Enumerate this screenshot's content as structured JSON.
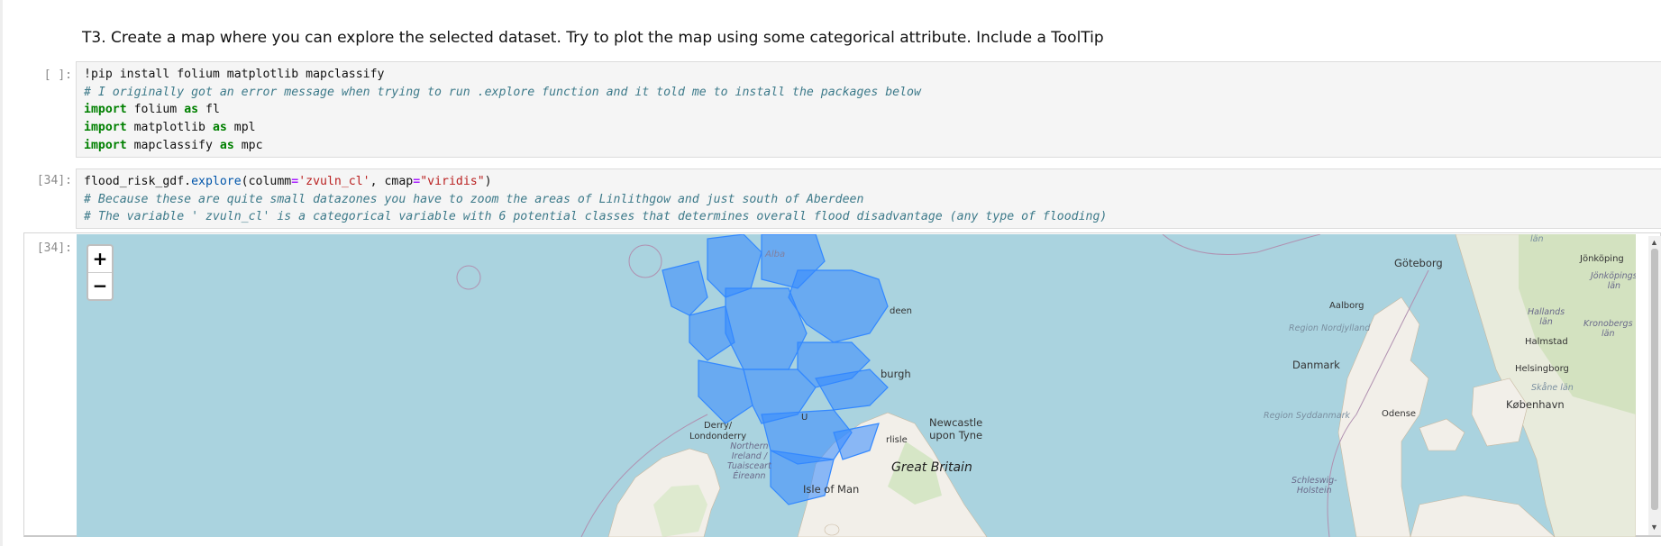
{
  "markdown": {
    "heading": "T3. Create a map where you can explore the selected dataset. Try to plot the map using some categorical attribute. Include a ToolTip"
  },
  "cell1": {
    "prompt": "[ ]:",
    "line1": "!pip install folium matplotlib mapclassify",
    "line2": "# I originally got an error message when trying to run .explore function and it told me to install the packages below",
    "line3_kw": "import",
    "line3_mod": "folium",
    "line3_as": "as",
    "line3_alias": "fl",
    "line4_kw": "import",
    "line4_mod": "matplotlib",
    "line4_as": "as",
    "line4_alias": "mpl",
    "line5_kw": "import",
    "line5_mod": "mapclassify",
    "line5_as": "as",
    "line5_alias": "mpc"
  },
  "cell2": {
    "prompt": "[34]:",
    "l1_obj": "flood_risk_gdf.",
    "l1_fn": "explore",
    "l1_a": "(columm",
    "l1_eq1": "=",
    "l1_s1": "'zvuln_cl'",
    "l1_b": ", cmap",
    "l1_eq2": "=",
    "l1_s2": "\"viridis\"",
    "l1_c": ")",
    "line2": "# Because these are quite small datazones you have to zoom the areas of Linlithgow and just south of Aberdeen",
    "line3": "# The variable ' zvuln_cl' is a categorical variable with 6 potential classes that determines overall flood disadvantage (any type of flooding)"
  },
  "output": {
    "prompt": "[34]:",
    "zoom_in": "+",
    "zoom_out": "−",
    "labels": {
      "alba": "Alba",
      "aberdeen": "deen",
      "edinburgh": "burgh",
      "derry": "Derry/\nLondonderry",
      "ni": "Northern\nIreland /\nTuaisceart\nÉireann",
      "newcastle": "Newcastle\nupon Tyne",
      "carlisle": "rlisle",
      "gb": "Great Britain",
      "isle_of_man": "Isle of Man",
      "goteborg": "Göteborg",
      "jonkoping": "Jönköping",
      "jonkoping_lan": "Jönköpings\nlän",
      "lan_top": "län",
      "aalborg": "Aalborg",
      "nordjylland": "Region Nordjylland",
      "hallands": "Hallands\nlän",
      "kronobergs": "Kronobergs\nlän",
      "halmstad": "Halmstad",
      "danmark": "Danmark",
      "helsingborg": "Helsingborg",
      "skane": "Skåne län",
      "kobenhavn": "København",
      "syddanmark": "Region Syddanmark",
      "odense": "Odense",
      "schleswig": "Schleswig-\nHolstein",
      "u": "U"
    }
  }
}
